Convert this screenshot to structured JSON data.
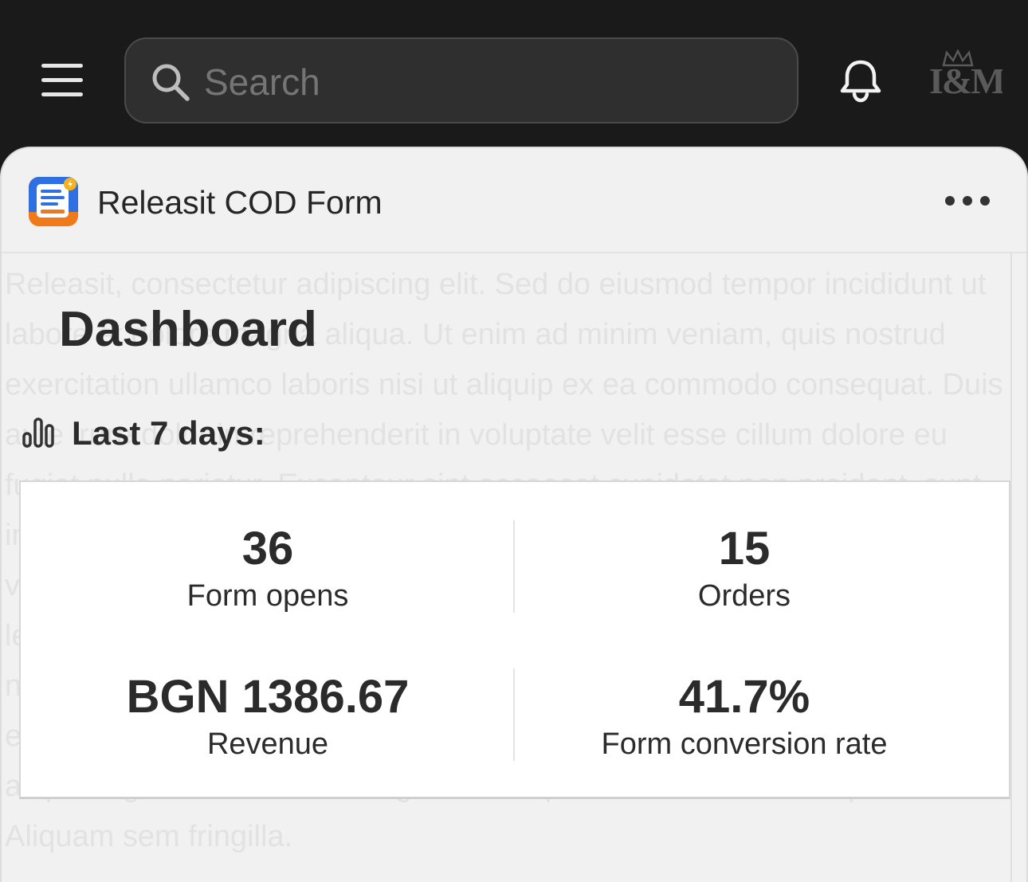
{
  "topbar": {
    "search_placeholder": "Search",
    "avatar_text": "I&M"
  },
  "app": {
    "title": "Releasit COD Form"
  },
  "page": {
    "title": "Dashboard",
    "range_label": "Last 7 days:"
  },
  "stats": [
    {
      "value": "36",
      "label": "Form opens"
    },
    {
      "value": "15",
      "label": "Orders"
    },
    {
      "value": "BGN 1386.67",
      "label": "Revenue"
    },
    {
      "value": "41.7%",
      "label": "Form conversion rate"
    }
  ],
  "background_text": "Releasit, consectetur adipiscing elit. Sed do eiusmod tempor incididunt ut labore et dolore magna aliqua. Ut enim ad minim veniam, quis nostrud exercitation ullamco laboris nisi ut aliquip ex ea commodo consequat. Duis aute irure dolor in reprehenderit in voluptate velit esse cillum dolore eu fugiat nulla pariatur. Excepteur sint occaecat cupidatat non proident, sunt in culpa qui officia deserunt mollit anim id est laborum. Phasellus vestibulum lorem sed risus ultricies tristique nulla aliquet enim. Augue ut lectus arcu bibendum at varius. Sagittis nisl rhoncus mattis rhoncus urna neque viverra justo. Vitae turpis massa sed quam nulla. Tristique senectus et netus et malesuada fames. Convallis aenean et tortor at risus viverra adipiscing at in. Ultricies mi eget mauris pharetra et ultrices neque ornare. Aliquam sem fringilla.",
  "icons": {
    "menu": "hamburger-icon",
    "search": "search-icon",
    "notifications": "bell-icon",
    "more": "ellipsis-icon",
    "chart": "bar-chart-icon"
  },
  "colors": {
    "topbar": "#1a1a1a",
    "search_bg": "#2f2f2f",
    "sheet_bg": "#f1f1f1",
    "card_bg": "#ffffff",
    "text": "#2b2b2b",
    "app_icon_blue": "#2f6fe4",
    "app_icon_orange": "#f07a1a",
    "app_icon_yellow": "#f6b21a"
  }
}
